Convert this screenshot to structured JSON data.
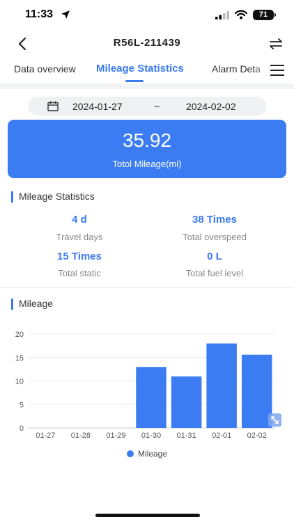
{
  "status_bar": {
    "time": "11:33",
    "battery": "71"
  },
  "nav": {
    "title": "R56L-211439"
  },
  "tabs": [
    {
      "label": "Data overview",
      "active": false
    },
    {
      "label": "Mileage Statistics",
      "active": true
    },
    {
      "label": "Alarm Deta",
      "active": false
    }
  ],
  "date_range": {
    "start": "2024-01-27",
    "separator": "~",
    "end": "2024-02-02"
  },
  "summary": {
    "value": "35.92",
    "label": "Totol Mileage(mi)"
  },
  "mileage_statistics": {
    "title": "Mileage Statistics",
    "stats": [
      {
        "value": "4 d",
        "label": "Travel days"
      },
      {
        "value": "38 Times",
        "label": "Total overspeed"
      },
      {
        "value": "15 Times",
        "label": "Total static"
      },
      {
        "value": "0 L",
        "label": "Total fuel level"
      }
    ]
  },
  "mileage_chart": {
    "title": "Mileage"
  },
  "chart_data": {
    "type": "bar",
    "categories": [
      "01-27",
      "01-28",
      "01-29",
      "01-30",
      "01-31",
      "02-01",
      "02-02"
    ],
    "series": [
      {
        "name": "Mileage",
        "values": [
          0,
          0,
          0,
          13,
          11,
          18,
          15.6
        ],
        "color": "#3c7cf2"
      }
    ],
    "yticks": [
      0,
      5,
      10,
      15,
      20
    ],
    "ylim": [
      0,
      20
    ],
    "grid": true,
    "legend": "bottom-center",
    "title": "",
    "xlabel": "",
    "ylabel": ""
  }
}
